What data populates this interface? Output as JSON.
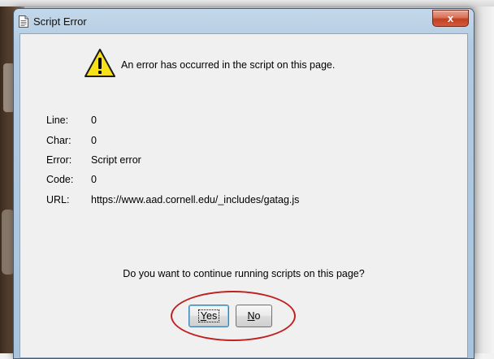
{
  "dialog": {
    "title": "Script Error",
    "close_label": "x",
    "message": "An error has occurred in the script on this page.",
    "details": [
      {
        "label": "Line:",
        "value": "0"
      },
      {
        "label": "Char:",
        "value": "0"
      },
      {
        "label": "Error:",
        "value": "Script error"
      },
      {
        "label": "Code:",
        "value": "0"
      },
      {
        "label": "URL:",
        "value": "https://www.aad.cornell.edu/_includes/gatag.js"
      }
    ],
    "question": "Do you want to continue running scripts on this page?",
    "yes_label": "Yes",
    "no_label": "No",
    "yes_mnemonic": "Y",
    "no_mnemonic": "N"
  },
  "colors": {
    "annotation_ellipse": "#c0201f",
    "warning_yellow": "#f7e21a",
    "close_button": "#c2401f"
  },
  "icons": {
    "title": "document-icon",
    "warning": "warning-triangle-icon",
    "close": "close-icon"
  }
}
